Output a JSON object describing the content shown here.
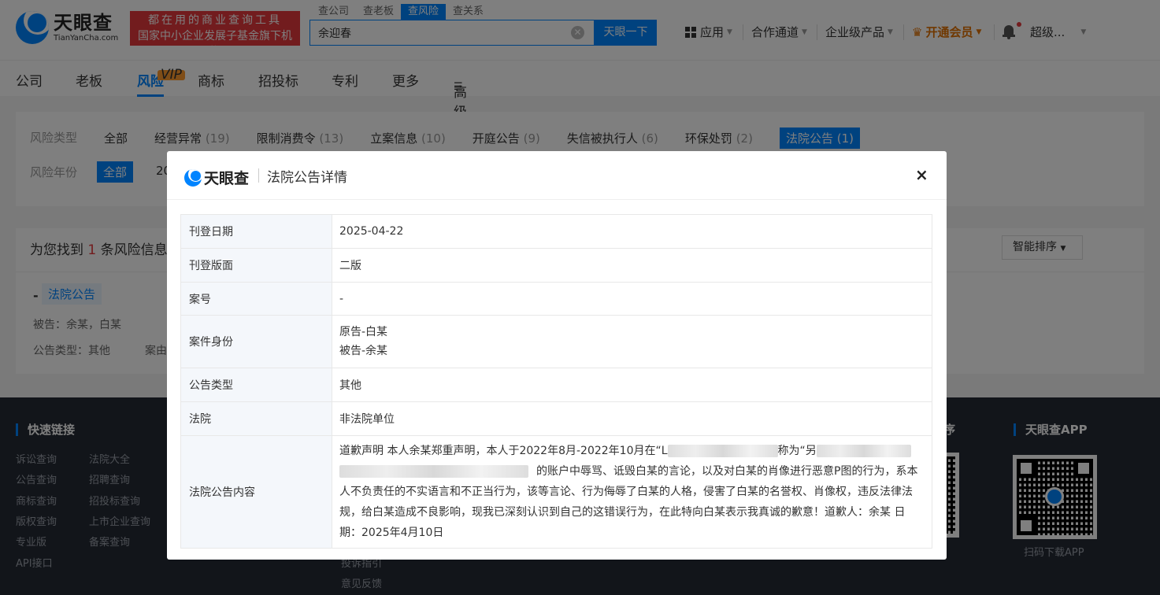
{
  "header": {
    "logo_cn": "天眼查",
    "logo_en": "TianYanCha.com",
    "slogan_line1": "都在用的商业查询工具",
    "slogan_line2": "国家中小企业发展子基金旗下机构",
    "search_tabs": [
      "查公司",
      "查老板",
      "查风险",
      "查关系"
    ],
    "search_active_tab": "查风险",
    "search_value": "余迎春",
    "search_button": "天眼一下",
    "nav_apps": "应用",
    "nav_partner": "合作通道",
    "nav_enterprise": "企业级产品",
    "nav_vip": "开通会员",
    "nav_user": "超级..."
  },
  "subnav": {
    "items": [
      "公司",
      "老板",
      "风险",
      "商标",
      "招投标",
      "专利",
      "更多"
    ],
    "active": "风险",
    "vip_badge": "VIP",
    "advanced_search": "高级搜索"
  },
  "filters": {
    "type_label": "风险类型",
    "types": [
      {
        "name": "全部",
        "count": ""
      },
      {
        "name": "经营异常",
        "count": "(19)"
      },
      {
        "name": "限制消费令",
        "count": "(13)"
      },
      {
        "name": "立案信息",
        "count": "(10)"
      },
      {
        "name": "开庭公告",
        "count": "(9)"
      },
      {
        "name": "失信被执行人",
        "count": "(6)"
      },
      {
        "name": "环保处罚",
        "count": "(2)"
      },
      {
        "name": "法院公告",
        "count": "(1)"
      }
    ],
    "year_label": "风险年份",
    "year_all": "全部",
    "year_partial": "20"
  },
  "results": {
    "found_prefix": "为您找到",
    "found_count": "1",
    "found_suffix": "条风险信息",
    "sort_label": "智能排序",
    "item_dash": "-",
    "item_tag": "法院公告",
    "item_defendant": "被告：余某，白某",
    "item_type": "公告类型：其他",
    "item_cause": "案由"
  },
  "footer": {
    "quick_links_title": "快速链接",
    "col1": [
      "诉讼查询",
      "公告查询",
      "商标查询",
      "版权查询",
      "专业版",
      "API接口"
    ],
    "col2": [
      "法院大全",
      "招聘查询",
      "招投标查询",
      "上市企业查询",
      "备案查询"
    ],
    "col3": [
      "投诉指引",
      "意见反馈"
    ],
    "mini_title_partial": "序",
    "app_title": "天眼查APP",
    "app_caption": "扫码下载APP"
  },
  "modal": {
    "logo": "天眼查",
    "title": "法院公告详情",
    "close": "×",
    "rows": [
      {
        "key": "刊登日期",
        "value": "2025-04-22"
      },
      {
        "key": "刊登版面",
        "value": "二版"
      },
      {
        "key": "案号",
        "value": "-"
      },
      {
        "key": "案件身份",
        "value_line1": "原告-白某",
        "value_line2": "被告-余某"
      },
      {
        "key": "公告类型",
        "value": "其他"
      },
      {
        "key": "法院",
        "value": "非法院单位"
      },
      {
        "key": "法院公告内容",
        "content_a": "道歉声明 本人余某郑重声明，本人于2022年8月-2022年10月在“L",
        "content_b": "称为“另",
        "content_c": "的账户中辱骂、诋毁白某的言论，以及对白某的肖像进行恶意P图的行为，系本人不负责任的不实语言和不正当行为，该等言论、行为侮辱了白某的人格，侵害了白某的名誉权、肖像权，违反法律法规，给白某造成不良影响，现我已深刻认识到自己的这错误行为，在此特向白某表示我真诚的歉意！道歉人：余某 日期：2025年4月10日"
      }
    ]
  },
  "colors": {
    "brand": "#0084ff",
    "accent_red": "#e4393c",
    "vip_orange": "#e07000"
  }
}
